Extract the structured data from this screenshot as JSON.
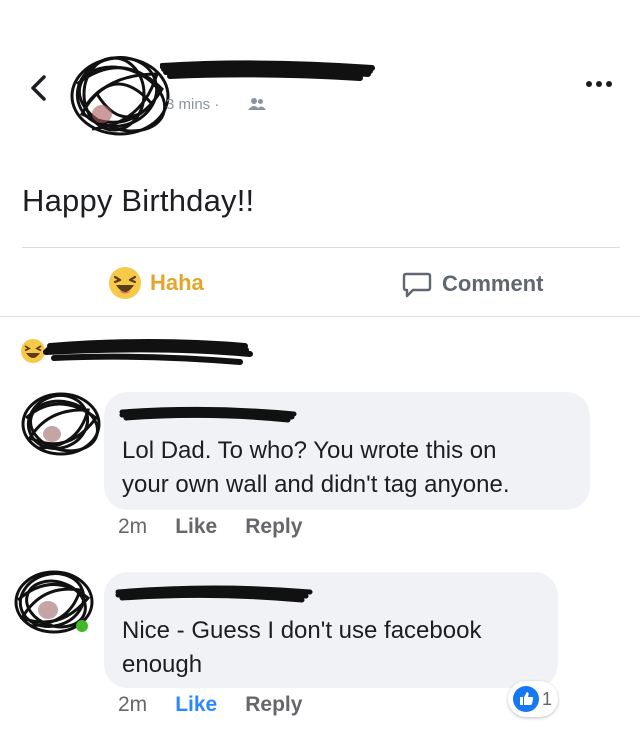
{
  "header": {
    "meta_text": "3 mins ·",
    "back_icon": "chevron-left-icon",
    "more_icon": "more-dots-icon"
  },
  "post": {
    "text": "Happy Birthday!!"
  },
  "actions": {
    "haha_label": "Haha",
    "comment_label": "Comment",
    "haha_color": "#e6a52a",
    "comment_color": "#606770"
  },
  "comments": [
    {
      "text_line1": "Lol Dad. To who? You wrote this on",
      "text_line2": "your own wall and didn't tag anyone.",
      "time": "2m",
      "like_label": "Like",
      "reply_label": "Reply"
    },
    {
      "text_line1": "Nice - Guess I don't use facebook",
      "text_line2": "enough",
      "time": "2m",
      "like_label": "Like",
      "reply_label": "Reply",
      "liked": true,
      "like_count": "1"
    }
  ],
  "colors": {
    "like_blue": "#2d88ff",
    "bubble_bg": "#f0f2f5"
  }
}
